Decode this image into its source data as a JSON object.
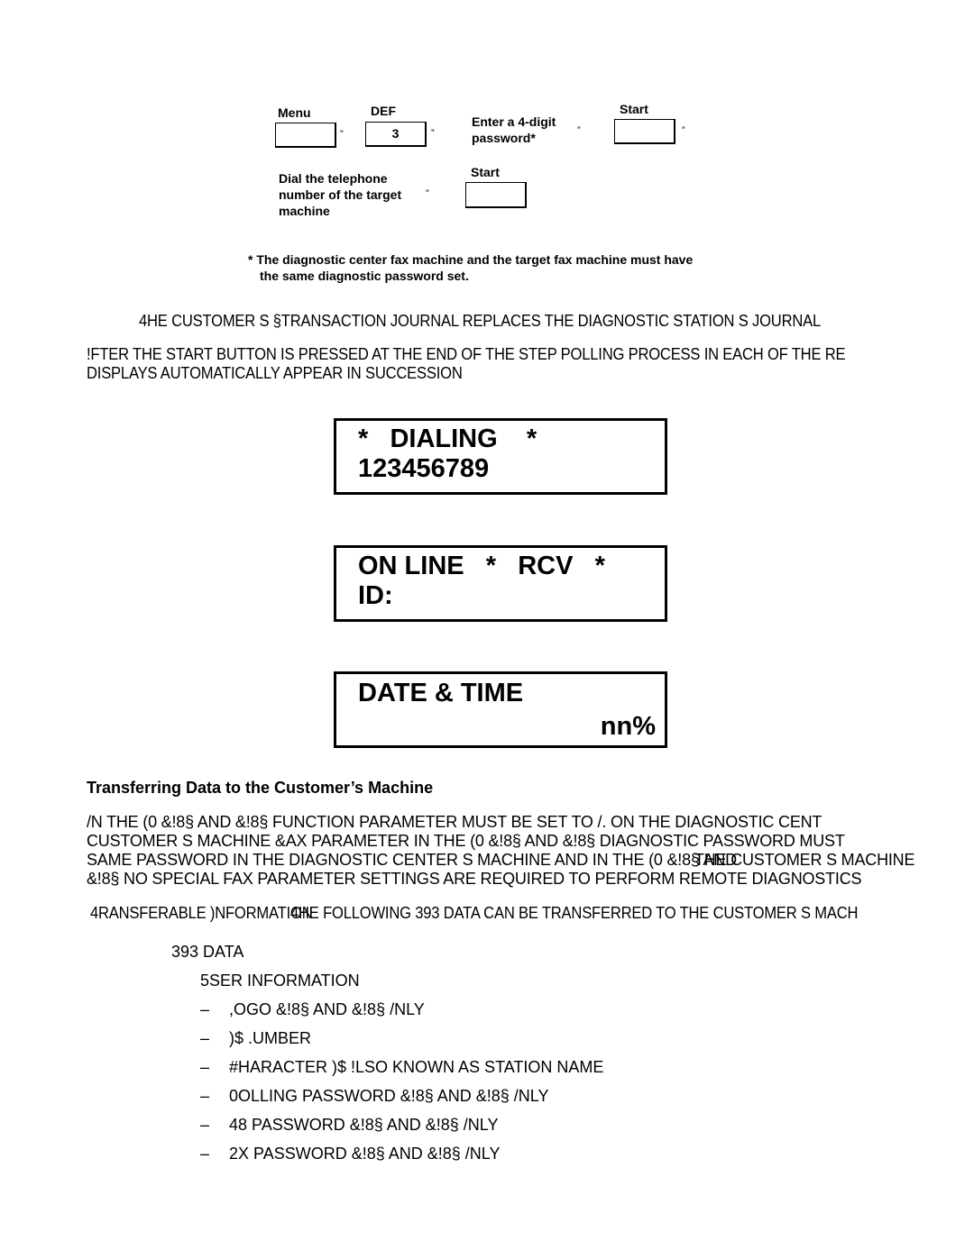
{
  "procedure": {
    "step1": {
      "menu_label": "Menu",
      "def_label": "DEF",
      "def_key_value": "3",
      "password_instruction": "Enter a 4-digit password*",
      "password_instruction_line1": "Enter a 4-digit",
      "password_instruction_line2": "password*",
      "start_label": "Start",
      "arrow": "”"
    },
    "step2": {
      "dial_instruction_line1": "Dial the telephone",
      "dial_instruction_line2": "number of the target",
      "dial_instruction_line3": "machine",
      "start_label": "Start",
      "arrow": "”"
    },
    "footnote_line1": "* The diagnostic center fax machine and the target fax machine must have",
    "footnote_line2": "the same diagnostic password set."
  },
  "paragraphs": {
    "journal_note": "4HE CUSTOMER S   §TRANSACTION JOURNAL REPLACES THE DIAGNOSTIC STATION S JOURNAL",
    "after_start_line1": "!FTER THE START BUTTON IS PRESSED AT THE END OF THE STEP   POLLING PROCESS IN EACH OF THE RE",
    "after_start_line2": "DISPLAYS AUTOMATICALLY APPEAR IN SUCCESSION"
  },
  "displays": [
    {
      "line1": "*   DIALING    *",
      "line2": "123456789"
    },
    {
      "line1": "ON LINE   *   RCV   *",
      "line2": "ID:"
    },
    {
      "line1": "DATE & TIME",
      "line2": "nn%"
    }
  ],
  "section": {
    "heading": "Transferring Data to the Customer’s Machine",
    "para_lines": [
      "/N THE (0 &!8§    AND &!8§          FUNCTION PARAMETER     MUST BE SET TO /. ON THE DIAGNOSTIC CENT",
      "CUSTOMER S MACHINE  &AX PARAMETER    IN THE (0 &!8§    AND &!8§     DIAGNOSTIC PASSWORD  MUST",
      "SAME  PASSWORD  IN  THE  DIAGNOSTIC  CENTER S  MACHINE  AND  IN  THE (0 &!8§ AND",
      "&!8§        NO SPECIAL FAX PARAMETER SETTINGS ARE REQUIRED TO PERFORM REMOTE DIAGNOSTICS"
    ],
    "para_overlap": "THE CUSTOMER S MACHINE",
    "transferable_label": "4RANSFERABLE )NFORMATION",
    "transferable_text": "4HE FOLLOWING 393 DATA CAN BE TRANSFERRED TO THE CUSTOMER S MACH",
    "list_title": "393 DATA",
    "list_subtitle": "5SER INFORMATION",
    "dash": "–",
    "items": [
      ",OGO  &!8§    AND &!8§    /NLY",
      ")$ .UMBER",
      "#HARACTER )$  !LSO KNOWN AS STATION NAME",
      "0OLLING PASSWORD  &!8§    AND &!8§    /NLY",
      "48 PASSWORD  &!8§    AND &!8§    /NLY",
      "2X PASSWORD  &!8§    AND &!8§    /NLY"
    ]
  }
}
